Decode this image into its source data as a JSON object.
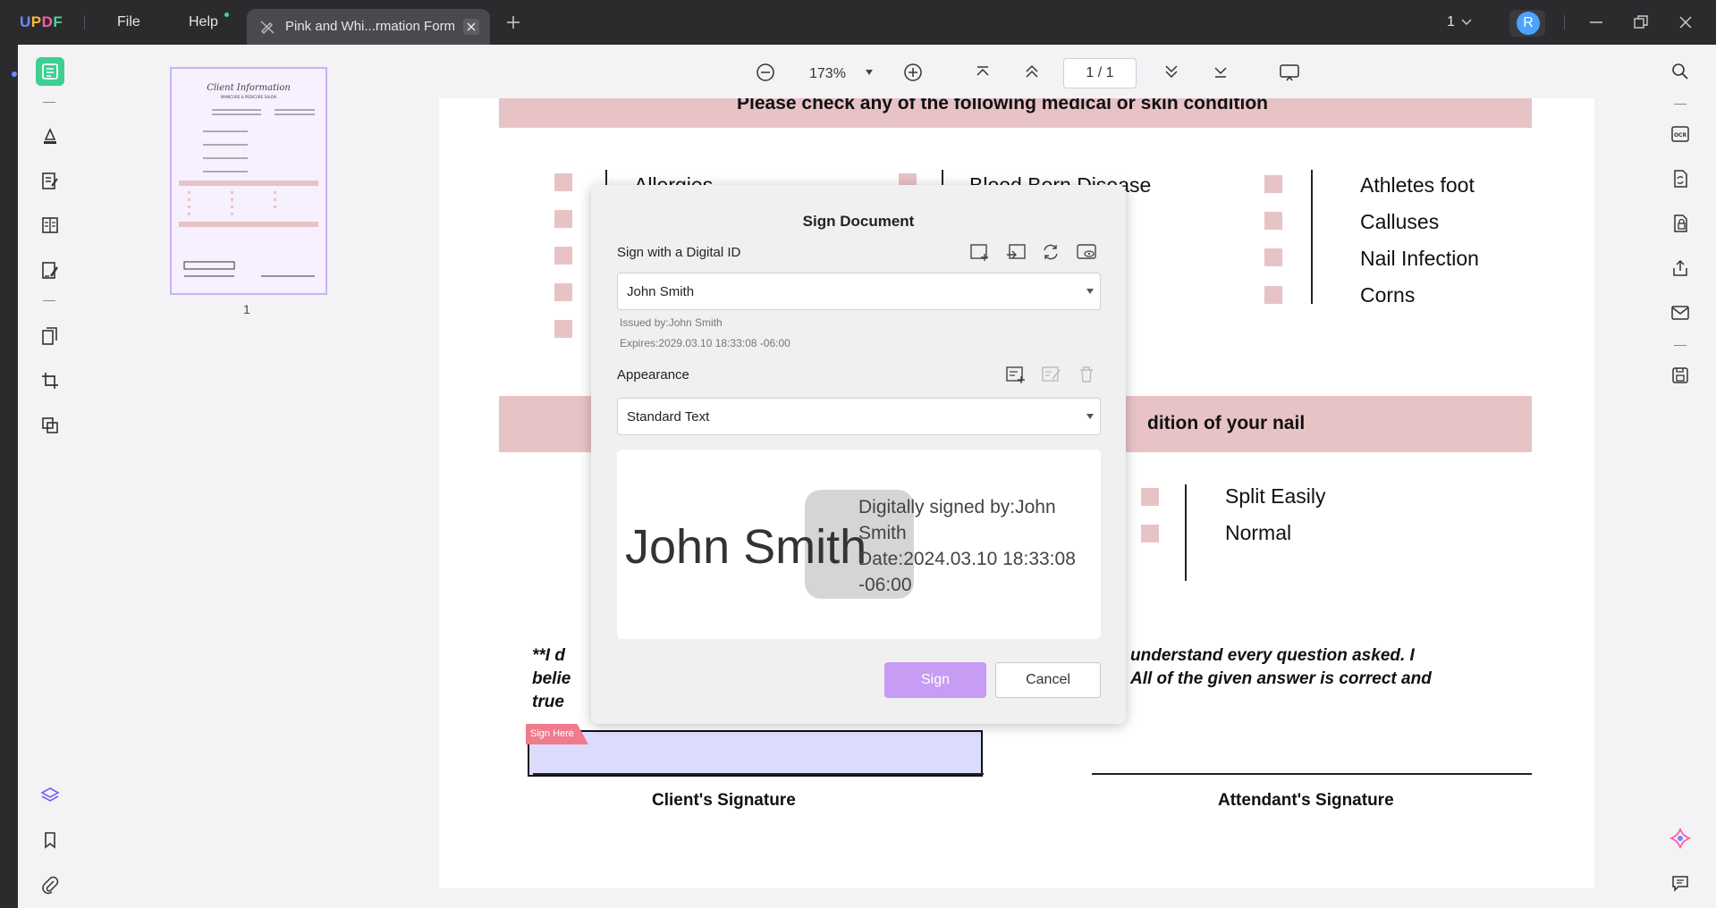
{
  "app": {
    "logo": "UPDF",
    "menu": {
      "file": "File",
      "help": "Help"
    },
    "tab_title": "Pink and Whi...rmation Form",
    "page_count_selector": "1"
  },
  "user": {
    "avatar_letter": "R",
    "avatar_color": "#4aa3ff"
  },
  "toolbar": {
    "zoom": "173%",
    "current_page": "1",
    "page_separator": "/",
    "total_pages": "1"
  },
  "thumbnail": {
    "page_number": "1"
  },
  "document": {
    "section_medical_heading": "Please check any of the following medical or skin condition",
    "conditions_col1": [
      "Allergies",
      "",
      "",
      "",
      ""
    ],
    "conditions_col2": [
      "Blood Born Disease"
    ],
    "conditions_col3": [
      "Athletes foot",
      "Calluses",
      "Nail Infection",
      "Corns"
    ],
    "section_nail_heading": "dition of your nail",
    "nail_conditions": [
      "Split Easily",
      "Normal"
    ],
    "declaration_left": [
      "**I d",
      "belie",
      "true"
    ],
    "declaration_right": [
      "understand every question asked. I",
      "All of the given answer is correct and"
    ],
    "sign_here_tag": "Sign Here",
    "client_signature_label": "Client's Signature",
    "attendant_signature_label": "Attendant's Signature"
  },
  "dialog": {
    "title": "Sign Document",
    "digital_id_label": "Sign with a Digital ID",
    "digital_id_value": "John Smith",
    "issued_by": "Issued by:John Smith",
    "expires": "Expires:2029.03.10 18:33:08 -06:00",
    "appearance_label": "Appearance",
    "appearance_value": "Standard Text",
    "preview": {
      "name": "John Smith",
      "signed_by_line1": "Digitally signed by:John",
      "signed_by_line2": "Smith",
      "date_line1": "Date:2024.03.10 18:33:08",
      "date_line2": "-06:00"
    },
    "sign_button": "Sign",
    "cancel_button": "Cancel"
  },
  "colors": {
    "accent_green": "#3fcf93",
    "sign_button": "#c69cf4",
    "pink_band": "#e8c3c6",
    "sign_field": "#dcdcfd"
  }
}
